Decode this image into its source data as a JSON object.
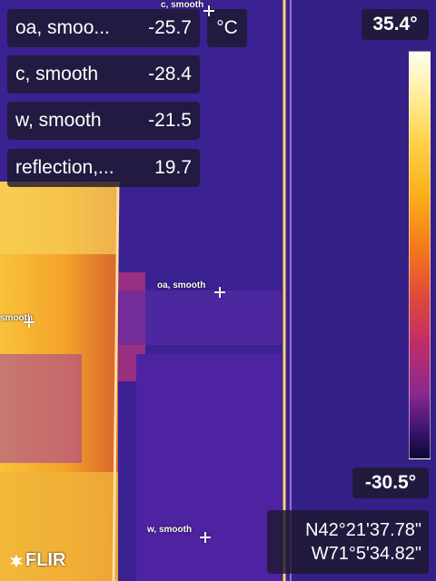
{
  "measurements": [
    {
      "label": "oa, smoo...",
      "value": "-25.7"
    },
    {
      "label": "c, smooth",
      "value": "-28.4"
    },
    {
      "label": "w, smooth",
      "value": "-21.5"
    },
    {
      "label": "reflection,...",
      "value": "19.7"
    }
  ],
  "unit": "°C",
  "scale": {
    "max": "35.4°",
    "min": "-30.5°"
  },
  "gps": {
    "lat": "N42°21'37.78\"",
    "lon": "W71°5'34.82\""
  },
  "spots": {
    "top": "c, smooth",
    "oa": "oa, smooth",
    "left": "smooth",
    "w": "w, smooth"
  },
  "brand": "FLIR",
  "colors": {
    "hot": "#ffd24a",
    "cold": "#3a1f8a",
    "panel": "#1e1830"
  }
}
